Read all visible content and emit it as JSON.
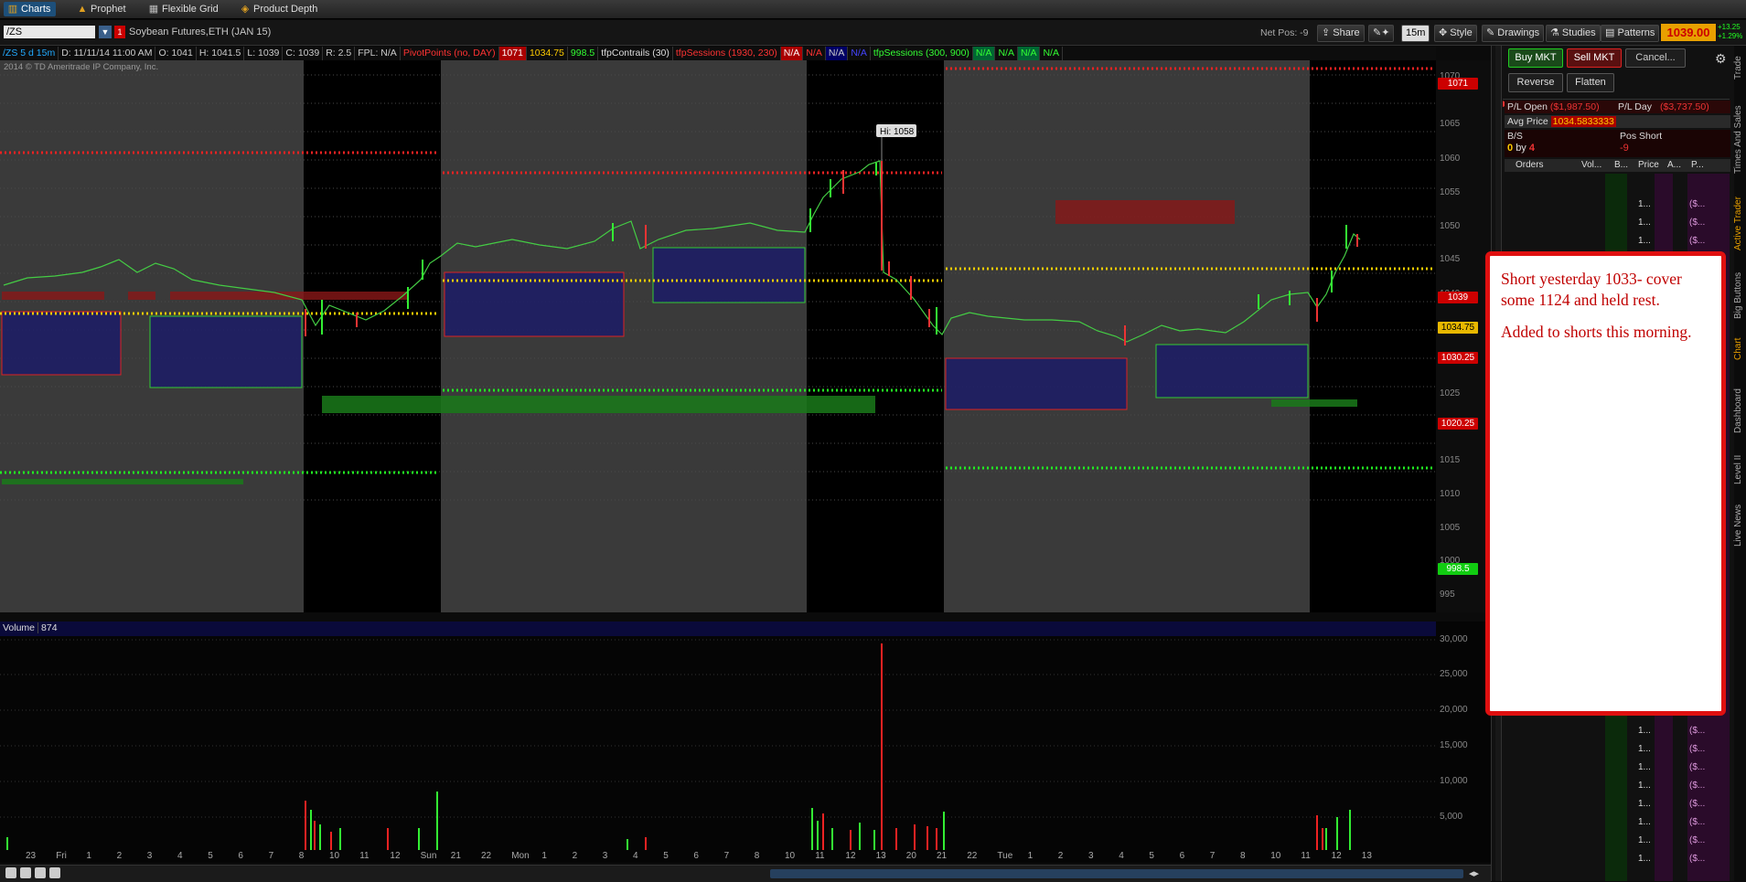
{
  "tabs": [
    {
      "label": "Charts",
      "icon": "chart-icon"
    },
    {
      "label": "Prophet",
      "icon": "prophet-icon"
    },
    {
      "label": "Flexible Grid",
      "icon": "grid-icon"
    },
    {
      "label": "Product Depth",
      "icon": "depth-icon"
    }
  ],
  "symbol": {
    "value": "/ZS",
    "name": "Soybean Futures,ETH (JAN 15)"
  },
  "toolbar": {
    "netpos": "Net Pos: -9",
    "share": "Share",
    "interval": "15m",
    "style": "Style",
    "drawings": "Drawings",
    "studies": "Studies",
    "patterns": "Patterns",
    "last_price": "1039.00",
    "change_up": "+13.25",
    "change_pct": "+1.29%"
  },
  "studybar": {
    "sym": "/ZS 5 d 15m",
    "date": "D: 11/11/14 11:00 AM",
    "open": "O: 1041",
    "high": "H: 1041.5",
    "low": "L: 1039",
    "close": "C: 1039",
    "range": "R: 2.5",
    "fpl": "FPL: N/A",
    "pivot": "PivotPoints (no, DAY)",
    "pivot_v1": "1071",
    "pivot_v2": "1034.75",
    "pivot_v3": "998.5",
    "contrails": "tfpContrails (30)",
    "sessions1": "tfpSessions (1930, 230)",
    "na": "N/A",
    "sessions2": "tfpSessions (300, 900)"
  },
  "copyright": "2014 © TD Ameritrade IP Company, Inc.",
  "hi_label": "Hi: 1058",
  "price_labels": {
    "p1071": "1071",
    "p1039": "1039",
    "p1034": "1034.75",
    "p1030": "1030.25",
    "p1020": "1020.25",
    "p998": "998.5"
  },
  "y_ticks": [
    "1070",
    "1065",
    "1060",
    "1055",
    "1050",
    "1045",
    "1040",
    "1035",
    "1030",
    "1025",
    "1020",
    "1015",
    "1010",
    "1005",
    "1000",
    "995"
  ],
  "volume": {
    "label": "Volume",
    "value": "874",
    "ticks": [
      "30,000",
      "25,000",
      "20,000",
      "15,000",
      "10,000",
      "5,000"
    ]
  },
  "x_ticks": [
    "23",
    "Fri",
    "1",
    "2",
    "3",
    "4",
    "5",
    "6",
    "7",
    "8",
    "10",
    "11",
    "12",
    "Sun",
    "21",
    "22",
    "Mon",
    "1",
    "2",
    "3",
    "4",
    "5",
    "6",
    "7",
    "8",
    "10",
    "11",
    "12",
    "13",
    "20",
    "21",
    "22",
    "Tue",
    "1",
    "2",
    "3",
    "4",
    "5",
    "6",
    "7",
    "8",
    "10",
    "11",
    "12",
    "13"
  ],
  "active_trader": {
    "buy": "Buy MKT",
    "sell": "Sell MKT",
    "cancel": "Cancel...",
    "reverse": "Reverse",
    "flatten": "Flatten",
    "pl_open_label": "P/L Open",
    "pl_open_value": "($1,987.50)",
    "pl_day_label": "P/L Day",
    "pl_day_value": "($3,737.50)",
    "avg_label": "Avg Price",
    "avg_value": "1034.5833333",
    "bs_label": "B/S",
    "bs_value_a": "0",
    "bs_by": "by",
    "bs_value_b": "4",
    "pos_label": "Pos Short",
    "pos_value": "-9",
    "cols": [
      "Orders",
      "Vol...",
      "B...",
      "Price",
      "A...",
      "P..."
    ],
    "price_cell": "1...",
    "p_cell": "($..."
  },
  "side_tabs": [
    "Trade",
    "Times And Sales",
    "Active Trader",
    "Big Buttons",
    "Chart",
    "Dashboard",
    "Level II",
    "Live News"
  ],
  "note": {
    "line1": "Short yesterday 1033- cover some 1124 and held rest.",
    "line2": "Added to shorts this morning."
  }
}
